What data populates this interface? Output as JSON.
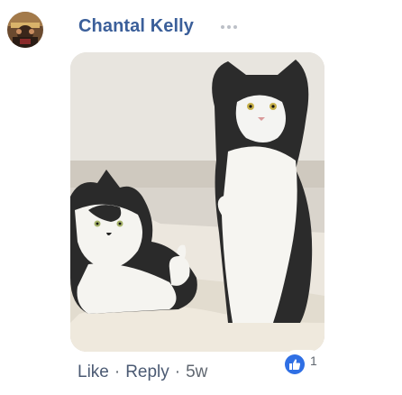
{
  "comment": {
    "author_name": "Chantal Kelly",
    "more_options_icon": "ellipsis-icon",
    "avatar_icon": "avatar-photo",
    "photo_icon": "cats-thumbs-up-photo",
    "actions": {
      "like_label": "Like",
      "separator": "·",
      "reply_label": "Reply",
      "timestamp": "5w"
    },
    "reactions": {
      "icon": "like-icon",
      "count": "1"
    },
    "colors": {
      "author": "#3b5f9a",
      "action_text": "#606770",
      "like_badge": "#2f6fe4"
    }
  }
}
